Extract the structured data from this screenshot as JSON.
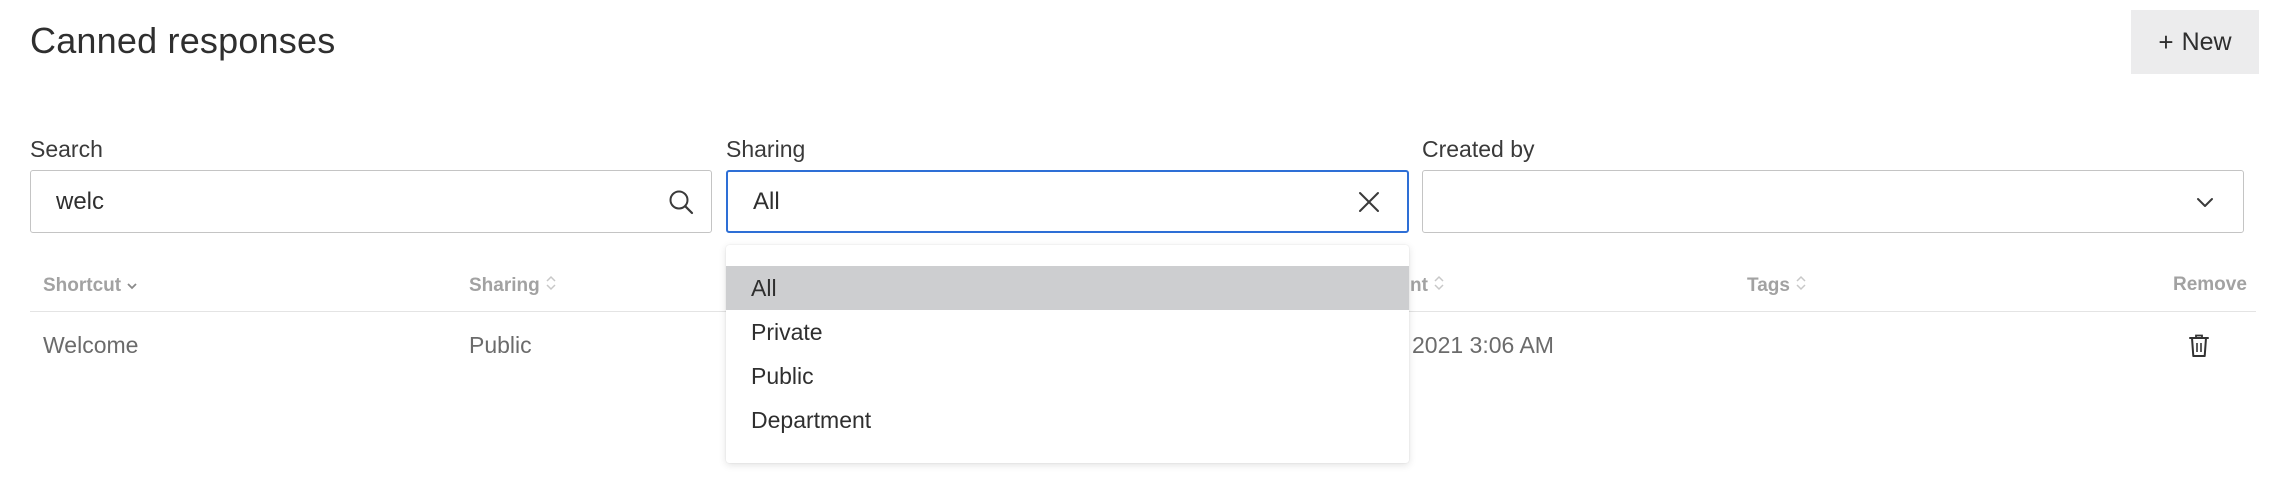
{
  "page": {
    "title": "Canned responses",
    "new_button": {
      "icon": "plus-icon",
      "label": "New"
    }
  },
  "filters": {
    "search": {
      "label": "Search",
      "value": "welc",
      "icon": "search-icon"
    },
    "sharing": {
      "label": "Sharing",
      "value": "All",
      "icon": "close-icon"
    },
    "created_by": {
      "label": "Created by",
      "value": "",
      "icon": "chevron-down-icon"
    }
  },
  "table": {
    "columns": [
      {
        "label": "Shortcut",
        "sortable": true
      },
      {
        "label": "Sharing",
        "sortable": true
      },
      {
        "label": "nt",
        "sortable": true
      },
      {
        "label": "Tags",
        "sortable": true
      },
      {
        "label": "Remove",
        "sortable": false
      }
    ],
    "rows": [
      {
        "shortcut": "Welcome",
        "sharing": "Public",
        "date_fragment": "2021 3:06 AM",
        "remove_icon": "trash-icon"
      }
    ]
  },
  "sharing_dropdown": {
    "open": true,
    "options": [
      "All",
      "Private",
      "Public",
      "Department"
    ],
    "selected": "All"
  },
  "colors": {
    "accent_focus": "#2e6fd6",
    "selected_option_bg": "#cdced0",
    "button_bg": "#ececed"
  }
}
